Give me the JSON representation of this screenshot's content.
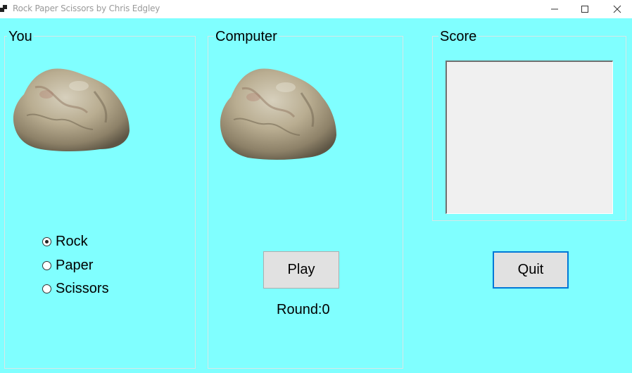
{
  "window": {
    "title": "Rock Paper Scissors by Chris Edgley"
  },
  "you": {
    "title": "You",
    "image": "rock-image",
    "options": [
      {
        "label": "Rock",
        "checked": true
      },
      {
        "label": "Paper",
        "checked": false
      },
      {
        "label": "Scissors",
        "checked": false
      }
    ]
  },
  "computer": {
    "title": "Computer",
    "image": "rock-image",
    "play_label": "Play",
    "round_label": "Round:0"
  },
  "score": {
    "title": "Score",
    "text": ""
  },
  "quit_label": "Quit",
  "colors": {
    "background": "#80ffff",
    "button": "#e1e1e1",
    "focus_border": "#0078d7"
  }
}
